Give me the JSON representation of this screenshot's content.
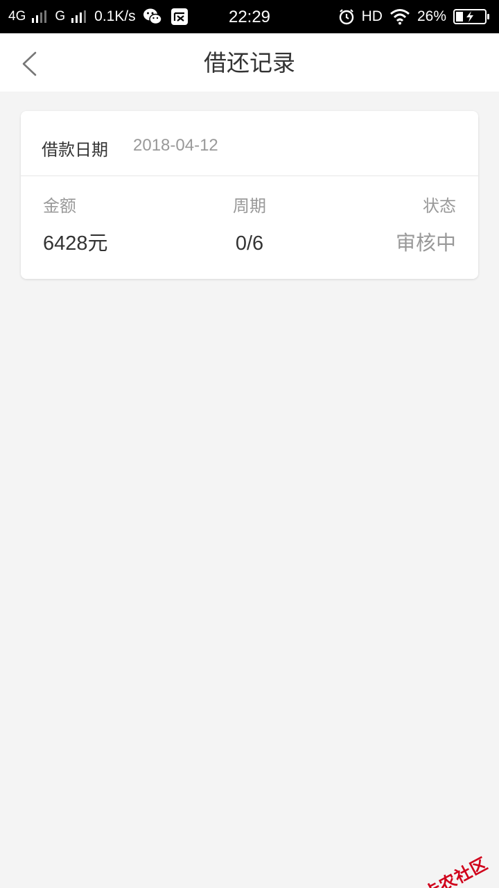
{
  "status_bar": {
    "network_1": "4G",
    "network_2": "G",
    "speed": "0.1K/s",
    "time": "22:29",
    "hd": "HD",
    "battery_percent": "26%",
    "battery_level": 0.26,
    "icons": [
      "signal-icon",
      "wechat-icon",
      "notification-icon",
      "alarm-icon",
      "wifi-icon",
      "battery-charging-icon"
    ]
  },
  "nav": {
    "title": "借还记录",
    "back_icon": "chevron-left-icon"
  },
  "record": {
    "date_label": "借款日期",
    "date_value": "2018-04-12",
    "amount_label": "金额",
    "amount_value": "6428元",
    "period_label": "周期",
    "period_value": "0/6",
    "status_label": "状态",
    "status_value": "审核中"
  },
  "watermark": {
    "text": "卡农社区"
  },
  "colors": {
    "background": "#f4f4f4",
    "card": "#ffffff",
    "text_primary": "#333333",
    "text_secondary": "#999999",
    "watermark": "#d0021b"
  }
}
